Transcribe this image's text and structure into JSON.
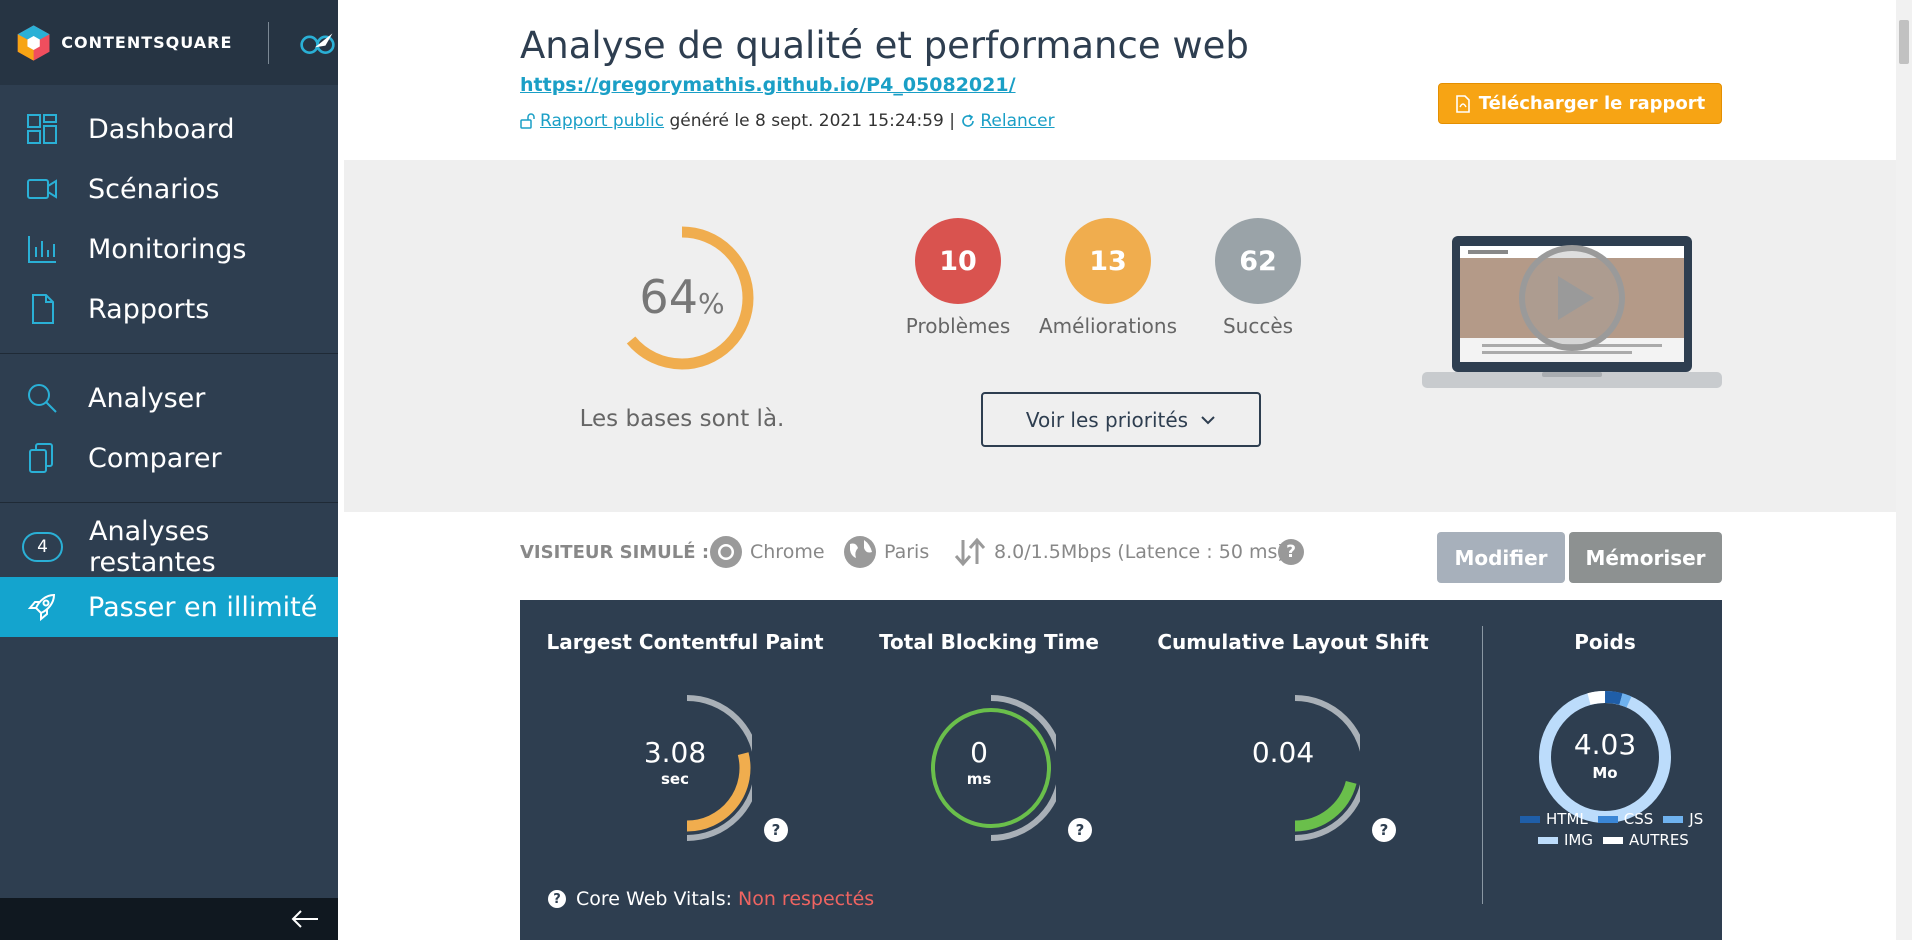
{
  "brand": {
    "name": "CONTENTSQUARE"
  },
  "sidebar": {
    "nav": [
      {
        "label": "Dashboard",
        "icon": "dashboard-icon"
      },
      {
        "label": "Scénarios",
        "icon": "video-icon"
      },
      {
        "label": "Monitorings",
        "icon": "chart-icon"
      },
      {
        "label": "Rapports",
        "icon": "document-icon"
      }
    ],
    "tools": [
      {
        "label": "Analyser",
        "icon": "search-icon"
      },
      {
        "label": "Comparer",
        "icon": "copy-icon"
      }
    ],
    "remaining": {
      "count": "4",
      "label": "Analyses restantes"
    },
    "upgrade": {
      "label": "Passer en illimité",
      "icon": "rocket-icon"
    }
  },
  "header": {
    "title": "Analyse de qualité et performance web",
    "url": "https://gregorymathis.github.io/P4_05082021/",
    "public_report_label": "Rapport public",
    "generated_text": " généré le 8 sept. 2021 15:24:59 | ",
    "relaunch_label": "Relancer",
    "download_label": "Télécharger le rapport"
  },
  "summary": {
    "score": "64",
    "score_pct_sign": "%",
    "score_fraction": 0.64,
    "caption": "Les bases sont là.",
    "counters": [
      {
        "value": "10",
        "label": "Problèmes",
        "color": "#d9534f"
      },
      {
        "value": "13",
        "label": "Améliorations",
        "color": "#f0ad4e"
      },
      {
        "value": "62",
        "label": "Succès",
        "color": "#9aa3a8"
      }
    ],
    "priorities_label": "Voir les priorités"
  },
  "simulation": {
    "label": "VISITEUR SIMULÉ :",
    "browser": "Chrome",
    "location": "Paris",
    "connection": "8.0/1.5Mbps (Latence : 50 ms)",
    "help": "?",
    "modify_label": "Modifier",
    "memorize_label": "Mémoriser"
  },
  "metrics": [
    {
      "title": "Largest Contentful Paint",
      "value": "3.08",
      "unit": "sec",
      "fraction": 0.58,
      "color": "#f0ad4e",
      "help": "?"
    },
    {
      "title": "Total Blocking Time",
      "value": "0",
      "unit": "ms",
      "fraction": 1.0,
      "color": "#6abf4b",
      "help": "?"
    },
    {
      "title": "Cumulative Layout Shift",
      "value": "0.04",
      "unit": "",
      "fraction": 0.42,
      "color": "#6abf4b",
      "help": "?"
    }
  ],
  "poids": {
    "title": "Poids",
    "value": "4.03",
    "unit": "Mo",
    "legend": [
      {
        "label": "HTML",
        "color": "#1f5ea8"
      },
      {
        "label": "CSS",
        "color": "#3a86d6"
      },
      {
        "label": "JS",
        "color": "#6fb2ef"
      },
      {
        "label": "IMG",
        "color": "#bcdcfb"
      },
      {
        "label": "AUTRES",
        "color": "#ffffff"
      }
    ]
  },
  "cwv": {
    "label": "Core Web Vitals:",
    "status": "Non respectés",
    "help": "?"
  },
  "colors": {
    "sidebar": "#2e3e50",
    "accent": "#14a4ce",
    "orange": "#f7a414"
  }
}
